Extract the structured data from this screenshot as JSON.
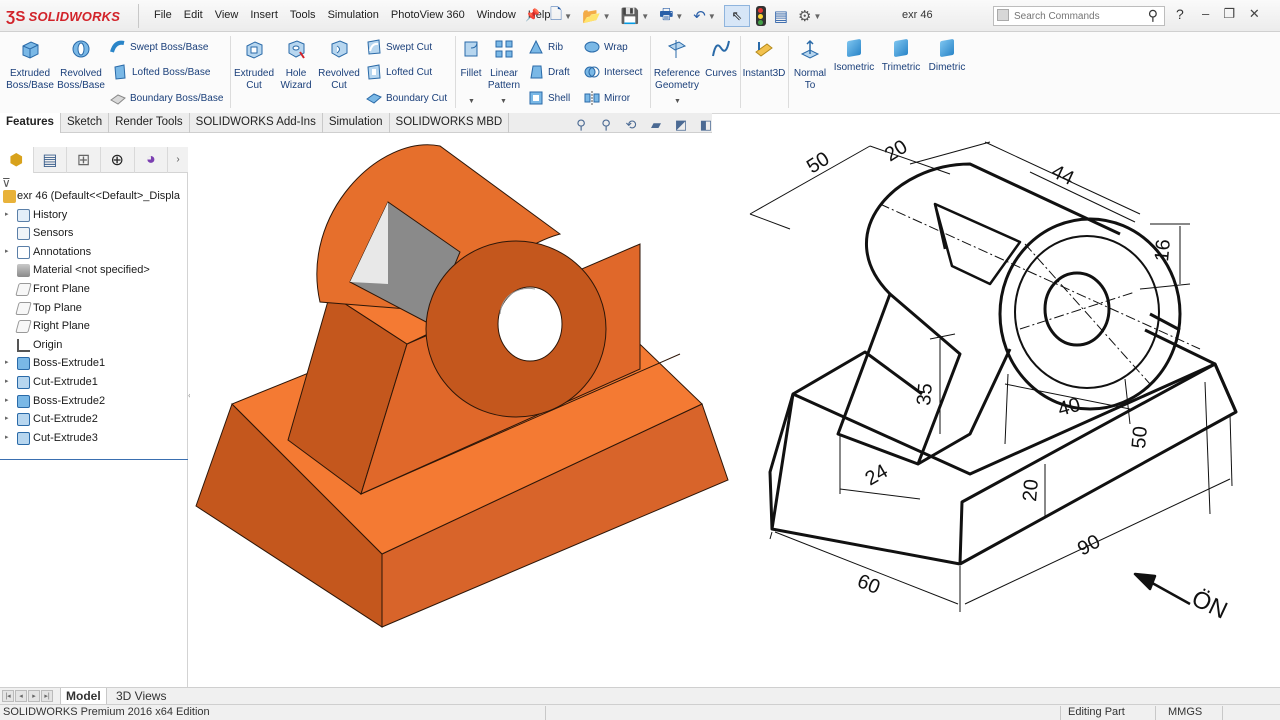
{
  "app": {
    "logo_text": "SOLIDWORKS",
    "menus": [
      "File",
      "Edit",
      "View",
      "Insert",
      "Tools",
      "Simulation",
      "PhotoView 360",
      "Window",
      "Help"
    ],
    "document_title": "exr 46",
    "search_placeholder": "Search Commands"
  },
  "ribbon": {
    "extruded_boss": "Extruded Boss/Base",
    "revolved_boss": "Revolved Boss/Base",
    "swept_boss": "Swept Boss/Base",
    "lofted_boss": "Lofted Boss/Base",
    "boundary_boss": "Boundary Boss/Base",
    "extruded_cut": "Extruded Cut",
    "hole_wizard": "Hole Wizard",
    "revolved_cut": "Revolved Cut",
    "swept_cut": "Swept Cut",
    "lofted_cut": "Lofted Cut",
    "boundary_cut": "Boundary Cut",
    "fillet": "Fillet",
    "linear_pattern": "Linear Pattern",
    "rib": "Rib",
    "draft": "Draft",
    "shell": "Shell",
    "wrap": "Wrap",
    "intersect": "Intersect",
    "mirror": "Mirror",
    "reference_geometry": "Reference Geometry",
    "curves": "Curves",
    "instant3d": "Instant3D",
    "normal_to": "Normal To",
    "isometric": "Isometric",
    "trimetric": "Trimetric",
    "dimetric": "Dimetric"
  },
  "tabs": [
    "Features",
    "Sketch",
    "Render Tools",
    "SOLIDWORKS Add-Ins",
    "Simulation",
    "SOLIDWORKS MBD"
  ],
  "tree": {
    "root": "exr 46  (Default<<Default>_Displa",
    "items": [
      "History",
      "Sensors",
      "Annotations",
      "Material <not specified>",
      "Front Plane",
      "Top Plane",
      "Right Plane",
      "Origin",
      "Boss-Extrude1",
      "Cut-Extrude1",
      "Boss-Extrude2",
      "Cut-Extrude2",
      "Cut-Extrude3"
    ]
  },
  "bottom_tabs": [
    "Model",
    "3D Views"
  ],
  "status": {
    "edition": "SOLIDWORKS Premium 2016 x64 Edition",
    "mode": "Editing Part",
    "units": "MMGS"
  },
  "drawing": {
    "dims": [
      "50",
      "20",
      "44",
      "16",
      "35",
      "40",
      "50",
      "20",
      "24",
      "60",
      "90"
    ],
    "view_label": "ÖN"
  },
  "colors": {
    "part_top": "#f47a33",
    "part_side": "#c4571d",
    "part_front": "#e0682a",
    "accent_blue": "#1a3f7a",
    "logo_red": "#d2232a"
  }
}
